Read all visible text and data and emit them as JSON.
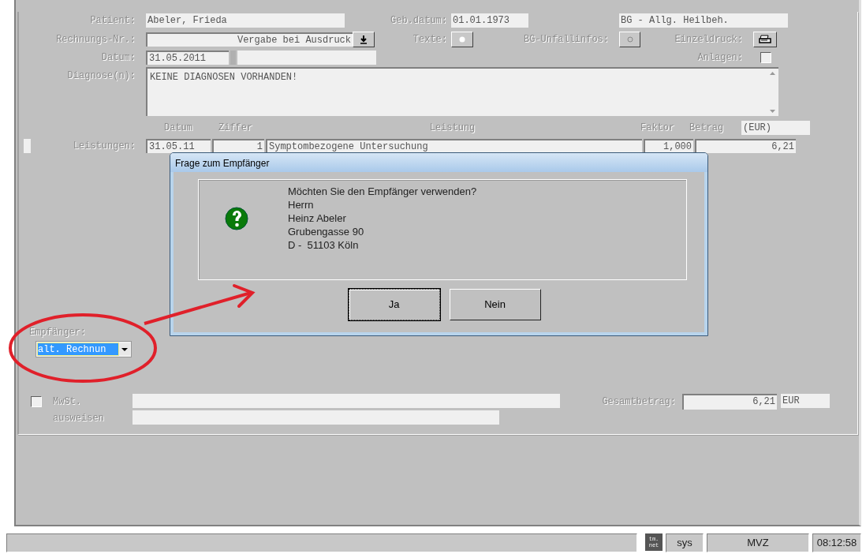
{
  "form": {
    "patient": {
      "label": "Patient:",
      "value": "Abeler, Frieda"
    },
    "geb_datum": {
      "label": "Geb.datum:",
      "value": "01.01.1973"
    },
    "kostentraeger": {
      "value": "BG - Allg. Heilbeh."
    },
    "rechnungs_nr": {
      "label": "Rechnungs-Nr.:",
      "value": "Vergabe bei Ausdruck"
    },
    "texte": {
      "label": "Texte:"
    },
    "bg_unfallinfos": {
      "label": "BG-Unfallinfos:"
    },
    "einzeldruck": {
      "label": "Einzeldruck:"
    },
    "datum": {
      "label": "Datum:",
      "value": "31.05.2011"
    },
    "anlagen": {
      "label": "Anlagen:",
      "checked": false
    },
    "diagnose": {
      "label": "Diagnose(n):",
      "value": "KEINE DIAGNOSEN VORHANDEN!"
    },
    "leistungen": {
      "label": "Leistungen:",
      "columns": [
        "Datum",
        "Ziffer",
        "Leistung",
        "Faktor",
        "Betrag"
      ],
      "unit": "(EUR)",
      "rows": [
        {
          "datum": "31.05.11",
          "ziffer": "1",
          "leistung": "Symptombezogene Untersuchung",
          "faktor": "1,000",
          "betrag": "6,21"
        }
      ]
    },
    "empfaenger": {
      "label": "Empfänger:",
      "value": "alt. Rechnun"
    },
    "mwst": {
      "label": "MwSt. ausweisen",
      "checked": false
    },
    "gesamtbetrag": {
      "label": "Gesamtbetrag:",
      "value": "6,21",
      "unit": "EUR"
    }
  },
  "dialog": {
    "title": "Frage zum Empfänger",
    "lines": [
      "Möchten Sie den Empfänger verwenden?",
      "Herrn",
      "Heinz Abeler",
      "Grubengasse 90",
      "D -  51103 Köln"
    ],
    "buttons": [
      {
        "label": "Ja",
        "default": true
      },
      {
        "label": "Nein",
        "default": false
      }
    ]
  },
  "status_bar": {
    "logo": "tm. net",
    "user": "sys",
    "site": "MVZ",
    "time": "08:12:58"
  }
}
